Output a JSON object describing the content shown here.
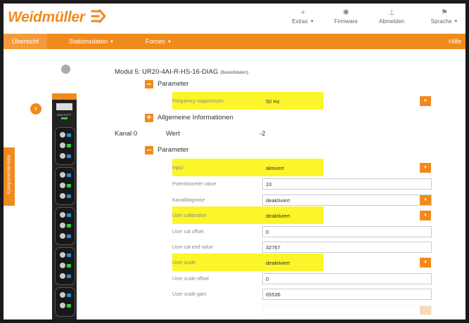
{
  "header": {
    "logo": "Weidmüller",
    "menu": [
      {
        "label": "Extras",
        "icon": "plus-icon",
        "has_caret": true
      },
      {
        "label": "Firmware",
        "icon": "gear-icon",
        "has_caret": false
      },
      {
        "label": "Abmelden",
        "icon": "logout-icon",
        "has_caret": false
      },
      {
        "label": "Sprache",
        "icon": "flag-icon",
        "has_caret": true
      }
    ]
  },
  "nav": {
    "overview": "Übersicht",
    "station_data": "Stationsdaten",
    "forcen": "Forcen",
    "help": "Hilfe"
  },
  "side": {
    "tab_label": "Komponentenliste"
  },
  "device": {
    "status_text": "RAN POTT"
  },
  "module": {
    "title": "Modul 5: UR20-4AI-R-HS-16-DIAG",
    "title_note": "(Bestelldaten)",
    "parameter_label": "Parameter",
    "general_info_label": "Allgemeine Informationen",
    "frequency": {
      "label": "Frequency suppression",
      "value": "50 Hz"
    }
  },
  "channel": {
    "label": "Kanal 0",
    "value_label": "Wert",
    "value": "-2",
    "parameter_label": "Parameter",
    "rows": [
      {
        "label": "Input",
        "value": "aktiviert",
        "type": "select",
        "highlighted": true
      },
      {
        "label": "Potentiometer value",
        "value": "10",
        "type": "text",
        "highlighted": false
      },
      {
        "label": "Kanaldiagnose",
        "value": "deaktiviert",
        "type": "select",
        "highlighted": false
      },
      {
        "label": "User calibration",
        "value": "deaktiviert",
        "type": "select",
        "highlighted": true
      },
      {
        "label": "User cal offset",
        "value": "0",
        "type": "text",
        "highlighted": false
      },
      {
        "label": "User cal end value",
        "value": "32767",
        "type": "text",
        "highlighted": false
      },
      {
        "label": "User scale",
        "value": "deaktiviert",
        "type": "select",
        "highlighted": true
      },
      {
        "label": "User scale offset",
        "value": "0",
        "type": "text",
        "highlighted": false
      },
      {
        "label": "User scale gain",
        "value": "65536",
        "type": "text",
        "highlighted": false
      }
    ]
  },
  "colors": {
    "accent": "#f08a1c",
    "highlight": "#fbf52a"
  }
}
